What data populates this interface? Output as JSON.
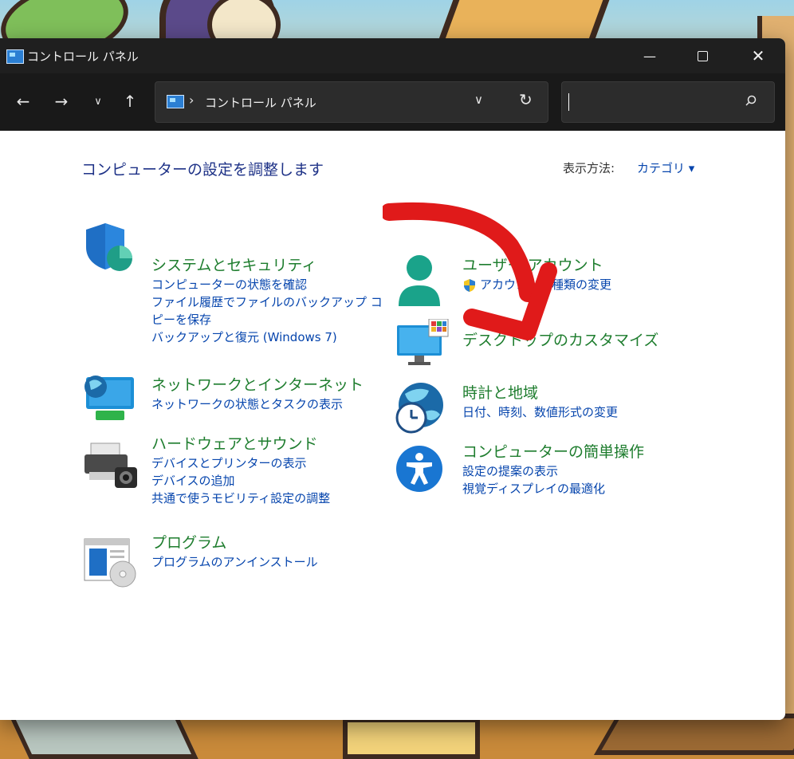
{
  "window": {
    "title": "コントロール パネル",
    "controls": {
      "minimize": "—",
      "maximize": "",
      "close": "✕"
    }
  },
  "navbar": {
    "back": "←",
    "forward": "→",
    "recent": "∨",
    "up": "↑",
    "address": {
      "separator": "›",
      "path": "コントロール パネル",
      "dropdown": "∨",
      "refresh": "↻"
    },
    "search": {
      "placeholder": "",
      "value": ""
    }
  },
  "content": {
    "heading": "コンピューターの設定を調整します",
    "view_by_label": "表示方法:",
    "view_by_value": "カテゴリ ▾"
  },
  "categories": {
    "system": {
      "title": "システムとセキュリティ",
      "links": [
        "コンピューターの状態を確認",
        "ファイル履歴でファイルのバックアップ コピーを保存",
        "バックアップと復元 (Windows 7)"
      ]
    },
    "network": {
      "title": "ネットワークとインターネット",
      "links": [
        "ネットワークの状態とタスクの表示"
      ]
    },
    "hardware": {
      "title": "ハードウェアとサウンド",
      "links": [
        "デバイスとプリンターの表示",
        "デバイスの追加",
        "共通で使うモビリティ設定の調整"
      ]
    },
    "programs": {
      "title": "プログラム",
      "links": [
        "プログラムのアンインストール"
      ]
    },
    "user": {
      "title": "ユーザー アカウント",
      "links": [
        "アカウントの種類の変更"
      ]
    },
    "appearance": {
      "title": "デスクトップのカスタマイズ",
      "links": []
    },
    "clock": {
      "title": "時計と地域",
      "links": [
        "日付、時刻、数値形式の変更"
      ]
    },
    "ease": {
      "title": "コンピューターの簡単操作",
      "links": [
        "設定の提案の表示",
        "視覚ディスプレイの最適化"
      ]
    }
  },
  "colors": {
    "category_title": "#1e7d2e",
    "link": "#0645ad",
    "heading": "#1e3287",
    "titlebar": "#1f1f1f",
    "arrow": "#e01a1a"
  }
}
